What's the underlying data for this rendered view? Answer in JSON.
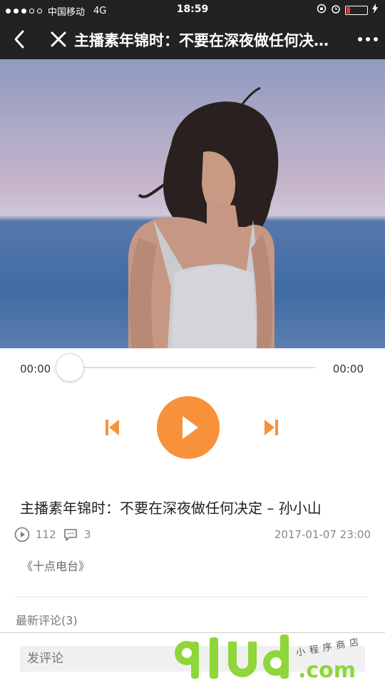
{
  "statusbar": {
    "carrier": "中国移动",
    "network": "4G",
    "time": "18:59"
  },
  "navbar": {
    "title": "主播素年锦时：不要在深夜做任何决定 – 孙小山"
  },
  "player": {
    "current_time": "00:00",
    "total_time": "00:00",
    "progress": 0
  },
  "episode": {
    "title": "主播素年锦时：不要在深夜做任何决定 – 孙小山",
    "plays": "112",
    "comments": "3",
    "date": "2017-01-07 23:00",
    "source": "《十点电台》"
  },
  "comments_section": {
    "heading": "最新评论(3)",
    "input_placeholder": "发评论"
  },
  "watermark": {
    "logo": "91ud",
    "domain": ".com",
    "tagline": "小程序商店"
  },
  "colors": {
    "accent": "#f7923a",
    "bar": "#222222"
  }
}
